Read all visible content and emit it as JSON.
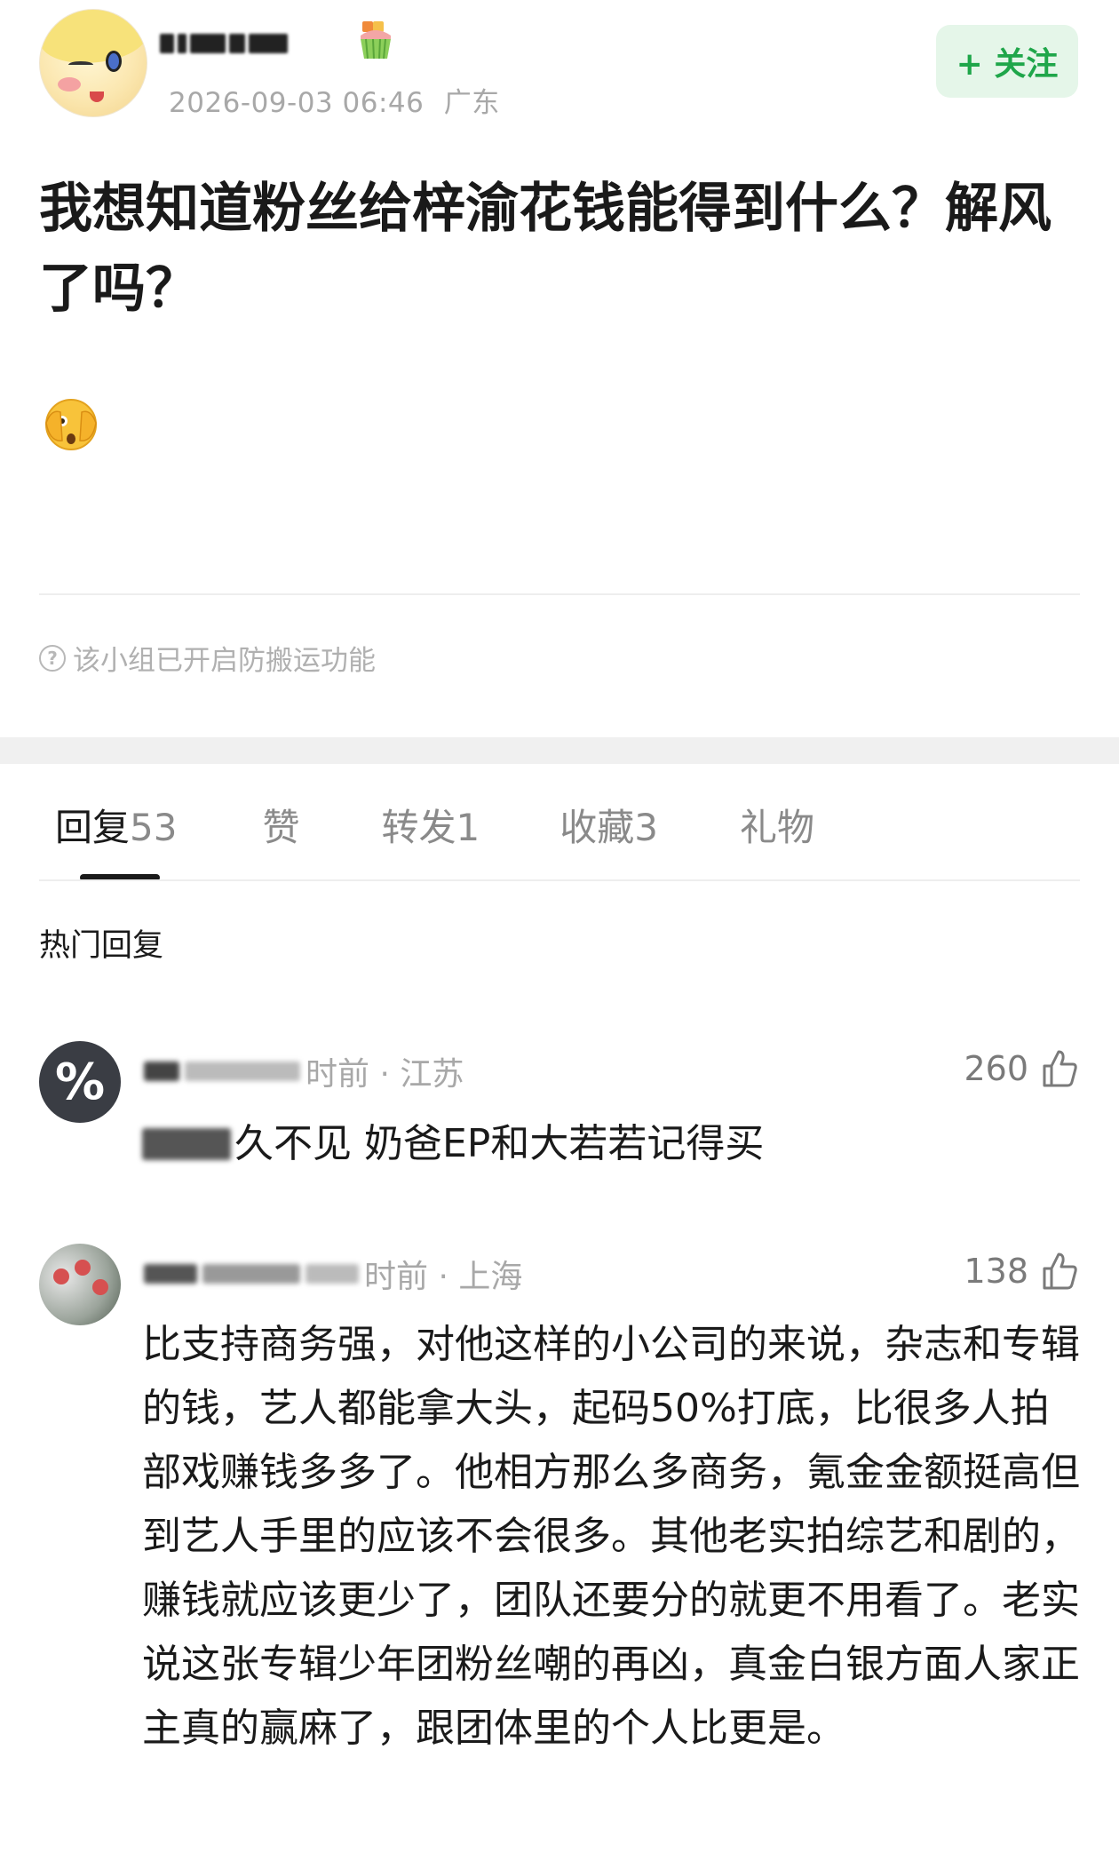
{
  "post": {
    "author_name": "",
    "date": "2026-09-03 06:46",
    "location": "广东",
    "follow_label": "+ 关注",
    "title": "我想知道粉丝给梓渝花钱能得到什么？解风了吗？",
    "notice": "该小组已开启防搬运功能"
  },
  "tabs": [
    {
      "label": "回复",
      "count": "53"
    },
    {
      "label": "赞",
      "count": ""
    },
    {
      "label": "转发",
      "count": "1"
    },
    {
      "label": "收藏",
      "count": "3"
    },
    {
      "label": "礼物",
      "count": ""
    }
  ],
  "section_heading": "热门回复",
  "comments": [
    {
      "time_location": "时前 · 江苏",
      "likes": "260",
      "body": "久不见 奶爸EP和大若若记得买"
    },
    {
      "time_location": "时前 · 上海",
      "likes": "138",
      "body": "比支持商务强，对他这样的小公司的来说，杂志和专辑的钱，艺人都能拿大头，起码50%打底，比很多人拍部戏赚钱多多了。他相方那么多商务，氪金金额挺高但到艺人手里的应该不会很多。其他老实拍综艺和剧的，赚钱就应该更少了，团队还要分的就更不用看了。老实说这张专辑少年团粉丝嘲的再凶，真金白银方面人家正主真的赢麻了，跟团体里的个人比更是。"
    }
  ],
  "colors": {
    "follow_green": "#1fa64a",
    "follow_bg": "#e5f6e9",
    "meta_gray": "#a8a8a8"
  },
  "icons": {
    "badge": "cupcake-icon",
    "emoji": "face-with-hand-over-eyes-icon",
    "notice": "question-circle-icon",
    "like": "thumbs-up-icon"
  }
}
